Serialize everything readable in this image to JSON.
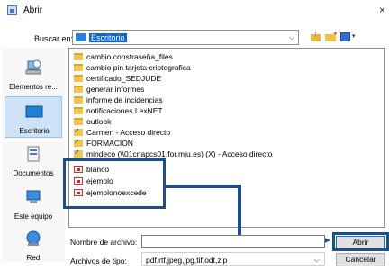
{
  "window": {
    "title": "Abrir",
    "close_glyph": "×"
  },
  "toolbar": {
    "lookin_label": "Buscar en:",
    "lookin_value": "Escritorio",
    "up_icon": "up-folder-icon",
    "new_folder_icon": "new-folder-icon",
    "view_icon": "view-menu-icon"
  },
  "places": [
    {
      "label": "Elementos re...",
      "icon": "recent-items-icon"
    },
    {
      "label": "Escritorio",
      "icon": "desktop-icon"
    },
    {
      "label": "Documentos",
      "icon": "documents-icon"
    },
    {
      "label": "Este equipo",
      "icon": "computer-icon"
    },
    {
      "label": "Red",
      "icon": "network-icon"
    }
  ],
  "files": [
    {
      "name": "cambio constraseña_files",
      "type": "folder"
    },
    {
      "name": "cambio pin tarjeta criptografica",
      "type": "folder"
    },
    {
      "name": "certificado_SEDJUDE",
      "type": "folder"
    },
    {
      "name": "generar informes",
      "type": "folder"
    },
    {
      "name": "informe de incidencias",
      "type": "folder"
    },
    {
      "name": "notificaciones LexNET",
      "type": "folder"
    },
    {
      "name": "outlook",
      "type": "folder"
    },
    {
      "name": "Carmen - Acceso directo",
      "type": "shortcut"
    },
    {
      "name": "FORMACION",
      "type": "shortcut"
    },
    {
      "name": "mindeco (\\\\01cnapcs01.for.mju.es) (X) - Acceso directo",
      "type": "shortcut"
    },
    {
      "name": "blanco",
      "type": "pdf"
    },
    {
      "name": "ejemplo",
      "type": "pdf"
    },
    {
      "name": "ejemplonoexcede",
      "type": "pdf"
    }
  ],
  "form": {
    "filename_label": "Nombre de archivo:",
    "filename_value": "",
    "filetype_label": "Archivos de tipo:",
    "filetype_value": "pdf,rtf,jpeg,jpg,tif,odt,zip"
  },
  "buttons": {
    "open": "Abrir",
    "cancel": "Cancelar"
  },
  "colors": {
    "highlight": "#1f4e8c",
    "selection": "#0a64d2"
  }
}
